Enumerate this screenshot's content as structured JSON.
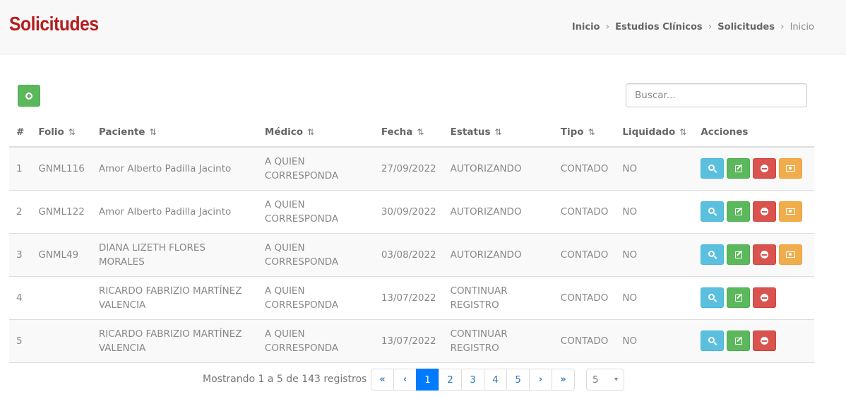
{
  "header": {
    "title": "Solicitudes",
    "breadcrumb": [
      "Inicio",
      "Estudios Clínicos",
      "Solicitudes",
      "Inicio"
    ],
    "title_color": "#b71c1c"
  },
  "search": {
    "placeholder": "Buscar..."
  },
  "table": {
    "columns": [
      {
        "label": "#",
        "sortable": false
      },
      {
        "label": "Folio",
        "sortable": true
      },
      {
        "label": "Paciente",
        "sortable": true
      },
      {
        "label": "Médico",
        "sortable": true
      },
      {
        "label": "Fecha",
        "sortable": true
      },
      {
        "label": "Estatus",
        "sortable": true
      },
      {
        "label": "Tipo",
        "sortable": true
      },
      {
        "label": "Liquidado",
        "sortable": true
      },
      {
        "label": "Acciones",
        "sortable": false
      }
    ],
    "sort_glyph": "⇅",
    "rows": [
      {
        "num": "1",
        "folio": "GNML116",
        "paciente": "Amor Alberto Padilla Jacinto",
        "medico": "A QUIEN CORRESPONDA",
        "fecha": "27/09/2022",
        "estatus": "AUTORIZANDO",
        "tipo": "CONTADO",
        "liquidado": "NO",
        "has_pay": true
      },
      {
        "num": "2",
        "folio": "GNML122",
        "paciente": "Amor Alberto Padilla Jacinto",
        "medico": "A QUIEN CORRESPONDA",
        "fecha": "30/09/2022",
        "estatus": "AUTORIZANDO",
        "tipo": "CONTADO",
        "liquidado": "NO",
        "has_pay": true
      },
      {
        "num": "3",
        "folio": "GNML49",
        "paciente": "DIANA LIZETH FLORES MORALES",
        "medico": "A QUIEN CORRESPONDA",
        "fecha": "03/08/2022",
        "estatus": "AUTORIZANDO",
        "tipo": "CONTADO",
        "liquidado": "NO",
        "has_pay": true
      },
      {
        "num": "4",
        "folio": "",
        "paciente": "RICARDO FABRIZIO MARTÍNEZ VALENCIA",
        "medico": "A QUIEN CORRESPONDA",
        "fecha": "13/07/2022",
        "estatus": "CONTINUAR REGISTRO",
        "tipo": "CONTADO",
        "liquidado": "NO",
        "has_pay": false
      },
      {
        "num": "5",
        "folio": "",
        "paciente": "RICARDO FABRIZIO MARTÍNEZ VALENCIA",
        "medico": "A QUIEN CORRESPONDA",
        "fecha": "13/07/2022",
        "estatus": "CONTINUAR REGISTRO",
        "tipo": "CONTADO",
        "liquidado": "NO",
        "has_pay": false
      }
    ]
  },
  "footer": {
    "info": "Mostrando 1 a 5 de 143 registros",
    "pages": [
      "1",
      "2",
      "3",
      "4",
      "5"
    ],
    "active_page": "1",
    "first_label": "«",
    "prev_label": "‹",
    "next_label": "›",
    "last_label": "»",
    "page_size": "5"
  },
  "colors": {
    "info": "#5bc0de",
    "success": "#5cb85c",
    "danger": "#d9534f",
    "warning": "#f0ad4e",
    "primary": "#007bff"
  }
}
